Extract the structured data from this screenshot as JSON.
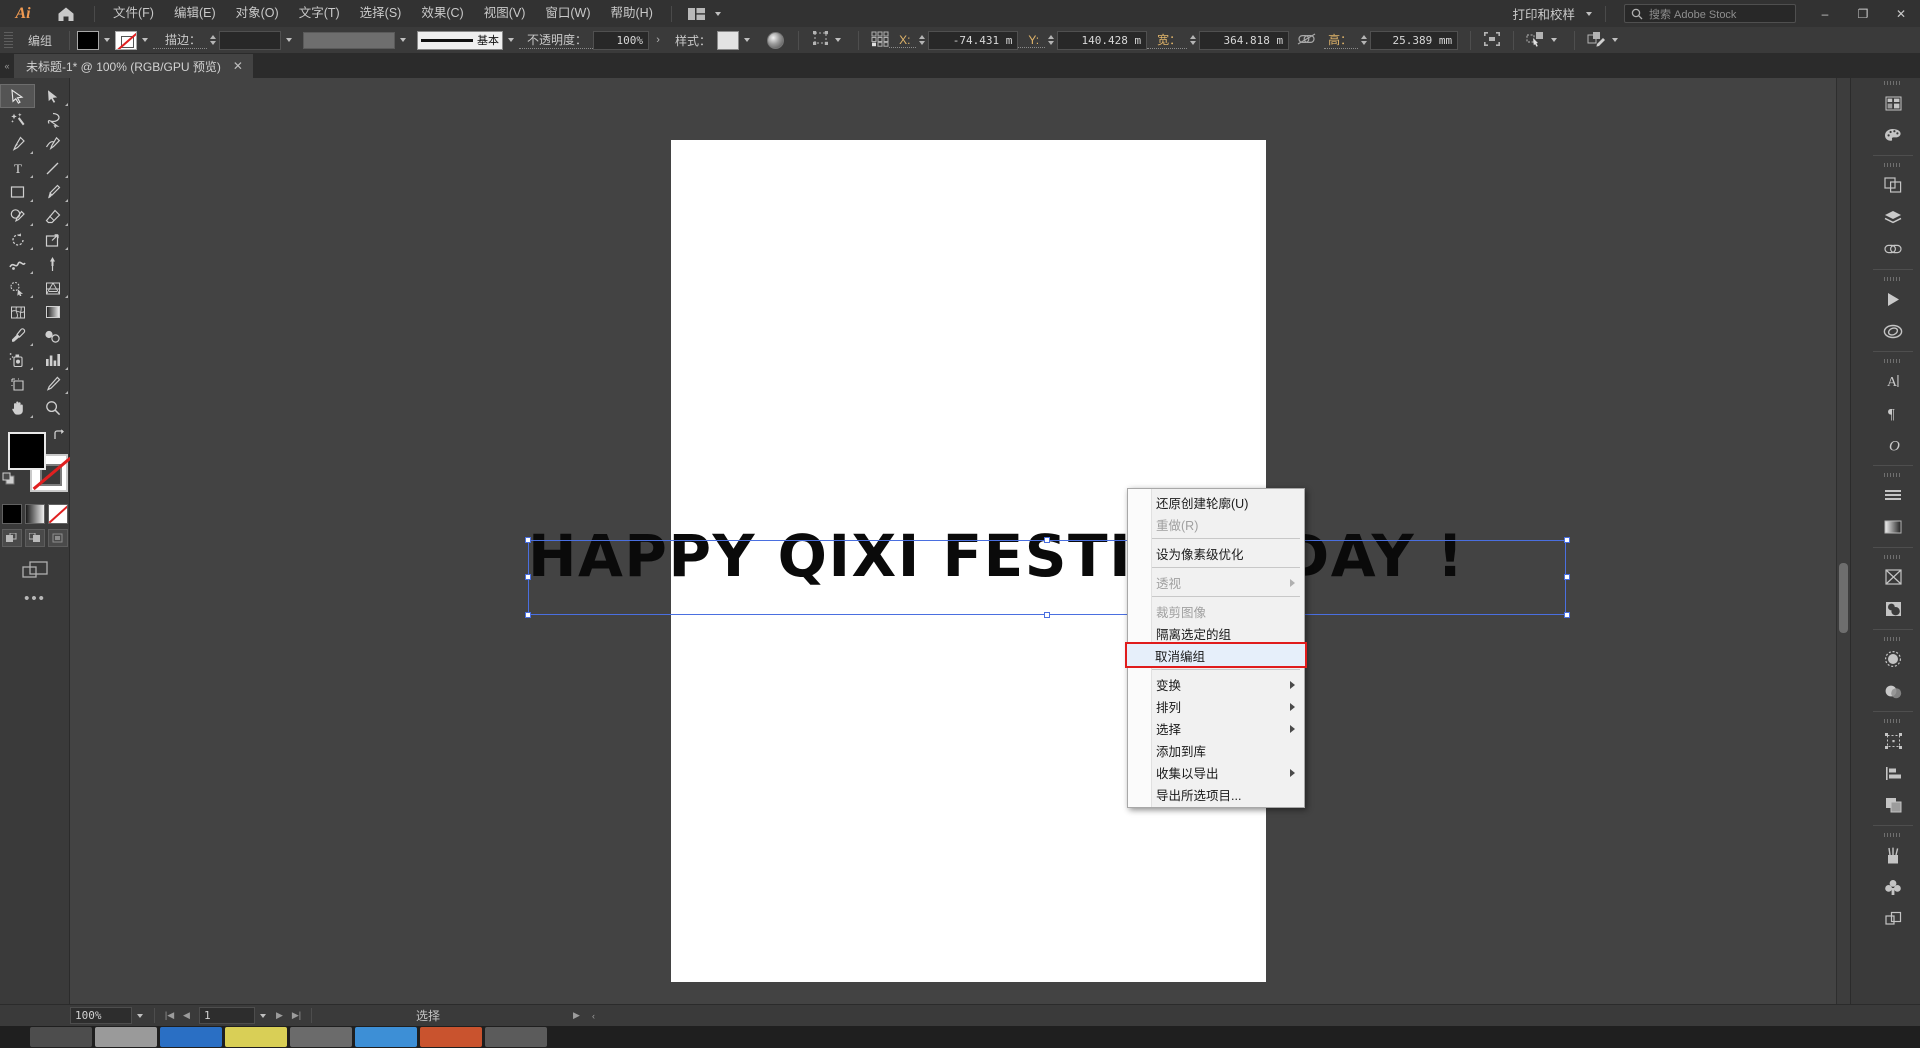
{
  "app": {
    "name": "Ai",
    "logo_icon": "illustrator-logo-icon",
    "home_icon": "home-icon"
  },
  "menubar": {
    "items": [
      {
        "label": "文件(F)",
        "name": "menu-file"
      },
      {
        "label": "编辑(E)",
        "name": "menu-edit"
      },
      {
        "label": "对象(O)",
        "name": "menu-object"
      },
      {
        "label": "文字(T)",
        "name": "menu-type"
      },
      {
        "label": "选择(S)",
        "name": "menu-select"
      },
      {
        "label": "效果(C)",
        "name": "menu-effect"
      },
      {
        "label": "视图(V)",
        "name": "menu-view"
      },
      {
        "label": "窗口(W)",
        "name": "menu-window"
      },
      {
        "label": "帮助(H)",
        "name": "menu-help"
      }
    ],
    "arrange_icon": "arrange-documents-icon",
    "workspace_label": "打印和校样",
    "search_placeholder": "搜索 Adobe Stock",
    "search_icon": "search-icon",
    "minimize": "–",
    "restore": "❐",
    "close": "✕"
  },
  "controlbar": {
    "selection_label": "编组",
    "fill_color": "#000000",
    "stroke_label": "描边：",
    "stroke_value": "",
    "stroke_profile_label": "基本",
    "opacity_label": "不透明度：",
    "opacity_value": "100%",
    "style_label": "样式：",
    "x_label": "X:",
    "x_value": "-74.431 m",
    "y_label": "Y:",
    "y_value": "140.428 m",
    "w_label": "宽：",
    "w_value": "364.818 m",
    "h_label": "高：",
    "h_value": "25.389 mm",
    "transform_icon": "transform-icon",
    "align_icon": "align-reference-icon",
    "link_icon": "constrain-proportions-icon",
    "distribute_icon": "distribute-icon",
    "select_similar_icon": "select-similar-icon",
    "more_options_icon": "more-options-icon"
  },
  "tabbar": {
    "tab_title": "未标题-1* @ 100% (RGB/GPU 预览)",
    "close_icon": "close-icon"
  },
  "toolbar": {
    "tools": [
      {
        "name": "selection-tool",
        "icon": "arrow-cursor-icon",
        "selected": true,
        "flyout": false
      },
      {
        "name": "direct-selection-tool",
        "icon": "direct-arrow-icon",
        "selected": false,
        "flyout": true
      },
      {
        "name": "magic-wand-tool",
        "icon": "magic-wand-icon",
        "selected": false,
        "flyout": false
      },
      {
        "name": "lasso-tool",
        "icon": "lasso-icon",
        "selected": false,
        "flyout": false
      },
      {
        "name": "pen-tool",
        "icon": "pen-icon",
        "selected": false,
        "flyout": true
      },
      {
        "name": "curvature-tool",
        "icon": "curvature-icon",
        "selected": false,
        "flyout": false
      },
      {
        "name": "type-tool",
        "icon": "type-T-icon",
        "selected": false,
        "flyout": true
      },
      {
        "name": "line-segment-tool",
        "icon": "line-icon",
        "selected": false,
        "flyout": true
      },
      {
        "name": "rectangle-tool",
        "icon": "rectangle-icon",
        "selected": false,
        "flyout": true
      },
      {
        "name": "paintbrush-tool",
        "icon": "paintbrush-icon",
        "selected": false,
        "flyout": true
      },
      {
        "name": "shaper-tool",
        "icon": "shaper-pencil-icon",
        "selected": false,
        "flyout": true
      },
      {
        "name": "eraser-tool",
        "icon": "eraser-icon",
        "selected": false,
        "flyout": true
      },
      {
        "name": "rotate-tool",
        "icon": "rotate-icon",
        "selected": false,
        "flyout": true
      },
      {
        "name": "scale-tool",
        "icon": "scale-icon",
        "selected": false,
        "flyout": true
      },
      {
        "name": "width-tool",
        "icon": "width-warp-icon",
        "selected": false,
        "flyout": true
      },
      {
        "name": "free-transform-tool",
        "icon": "pushpin-icon",
        "selected": false,
        "flyout": false
      },
      {
        "name": "shape-builder-tool",
        "icon": "shape-builder-icon",
        "selected": false,
        "flyout": true
      },
      {
        "name": "perspective-grid-tool",
        "icon": "perspective-grid-icon",
        "selected": false,
        "flyout": true
      },
      {
        "name": "mesh-tool",
        "icon": "mesh-icon",
        "selected": false,
        "flyout": false
      },
      {
        "name": "gradient-tool",
        "icon": "gradient-icon",
        "selected": false,
        "flyout": false
      },
      {
        "name": "eyedropper-tool",
        "icon": "eyedropper-icon",
        "selected": false,
        "flyout": true
      },
      {
        "name": "blend-tool",
        "icon": "blend-icon",
        "selected": false,
        "flyout": false
      },
      {
        "name": "symbol-sprayer-tool",
        "icon": "symbol-sprayer-icon",
        "selected": false,
        "flyout": true
      },
      {
        "name": "column-graph-tool",
        "icon": "bar-chart-icon",
        "selected": false,
        "flyout": true
      },
      {
        "name": "artboard-tool",
        "icon": "artboard-icon",
        "selected": false,
        "flyout": false
      },
      {
        "name": "slice-tool",
        "icon": "slice-knife-icon",
        "selected": false,
        "flyout": true
      },
      {
        "name": "hand-tool",
        "icon": "hand-icon",
        "selected": false,
        "flyout": true
      },
      {
        "name": "zoom-tool",
        "icon": "magnifier-icon",
        "selected": false,
        "flyout": false
      }
    ],
    "fill_color": "#000000",
    "stroke_color": "none",
    "swap_icon": "swap-fill-stroke-icon",
    "default_icon": "default-fill-stroke-icon",
    "color_mode_icon": "flat-color-icon",
    "gradient_mode_icon": "gradient-color-icon",
    "none_mode_icon": "none-color-icon",
    "draw_normal_icon": "draw-normal-icon",
    "draw_behind_icon": "draw-behind-icon",
    "draw_inside_icon": "draw-inside-icon",
    "screen_mode_icon": "screen-mode-icon",
    "edit_toolbar_icon": "edit-toolbar-dots-icon"
  },
  "canvas": {
    "artwork_text": "HAPPY QIXI FESTIVAL DAY !",
    "selection_color": "#4a6fe0",
    "artboard_color": "#ffffff",
    "canvas_bg": "#434343"
  },
  "contextmenu": {
    "items": [
      {
        "label": "还原创建轮廓(U)",
        "name": "ctx-undo-create-outlines",
        "disabled": false,
        "submenu": false,
        "highlighted": false
      },
      {
        "label": "重做(R)",
        "name": "ctx-redo",
        "disabled": true,
        "submenu": false,
        "highlighted": false
      },
      {
        "sep": true
      },
      {
        "label": "设为像素级优化",
        "name": "ctx-make-pixel-perfect",
        "disabled": false,
        "submenu": false,
        "highlighted": false
      },
      {
        "sep": true
      },
      {
        "label": "透视",
        "name": "ctx-perspective",
        "disabled": true,
        "submenu": true,
        "highlighted": false
      },
      {
        "sep": true
      },
      {
        "label": "裁剪图像",
        "name": "ctx-crop-image",
        "disabled": true,
        "submenu": false,
        "highlighted": false
      },
      {
        "label": "隔离选定的组",
        "name": "ctx-isolate-selected-group",
        "disabled": false,
        "submenu": false,
        "highlighted": false
      },
      {
        "label": "取消编组",
        "name": "ctx-ungroup",
        "disabled": false,
        "submenu": false,
        "highlighted": true
      },
      {
        "sep": true
      },
      {
        "label": "变换",
        "name": "ctx-transform",
        "disabled": false,
        "submenu": true,
        "highlighted": false
      },
      {
        "label": "排列",
        "name": "ctx-arrange",
        "disabled": false,
        "submenu": true,
        "highlighted": false
      },
      {
        "label": "选择",
        "name": "ctx-select",
        "disabled": false,
        "submenu": true,
        "highlighted": false
      },
      {
        "label": "添加到库",
        "name": "ctx-add-to-library",
        "disabled": false,
        "submenu": false,
        "highlighted": false
      },
      {
        "label": "收集以导出",
        "name": "ctx-collect-for-export",
        "disabled": false,
        "submenu": true,
        "highlighted": false
      },
      {
        "label": "导出所选项目...",
        "name": "ctx-export-selection",
        "disabled": false,
        "submenu": false,
        "highlighted": false
      }
    ],
    "highlight_color": "#e01c1c"
  },
  "rightdock": {
    "groups": [
      {
        "icons": [
          {
            "name": "properties-panel-icon",
            "icon": "properties-grid-icon"
          },
          {
            "name": "color-panel-icon",
            "icon": "palette-icon"
          }
        ]
      },
      {
        "icons": [
          {
            "name": "pathfinder-panel-icon",
            "icon": "pathfinder-icon"
          },
          {
            "name": "layers-panel-icon",
            "icon": "layers-stack-icon"
          },
          {
            "name": "links-panel-icon",
            "icon": "chain-link-icon"
          }
        ]
      },
      {
        "icons": [
          {
            "name": "actions-panel-icon",
            "icon": "play-triangle-icon"
          },
          {
            "name": "creative-cloud-libraries-icon",
            "icon": "cc-libraries-icon"
          }
        ]
      },
      {
        "icons": [
          {
            "name": "character-panel-icon",
            "icon": "character-A-icon"
          },
          {
            "name": "paragraph-panel-icon",
            "icon": "pilcrow-icon"
          },
          {
            "name": "glyphs-panel-icon",
            "icon": "glyph-O-icon"
          }
        ]
      },
      {
        "icons": [
          {
            "name": "align-panel-icon",
            "icon": "align-lines-icon"
          },
          {
            "name": "gradient-panel-icon",
            "icon": "gradient-bar-icon"
          }
        ]
      },
      {
        "icons": [
          {
            "name": "image-trace-panel-icon",
            "icon": "image-trace-icon"
          },
          {
            "name": "transparency-panel-icon",
            "icon": "transparency-icon"
          }
        ]
      },
      {
        "icons": [
          {
            "name": "appearance-panel-icon",
            "icon": "appearance-circle-icon"
          },
          {
            "name": "graphic-styles-panel-icon",
            "icon": "graphic-styles-icon"
          }
        ]
      },
      {
        "icons": [
          {
            "name": "transform-panel-icon",
            "icon": "transform-box-icon"
          },
          {
            "name": "align-objects-panel-icon",
            "icon": "align-objects-icon"
          },
          {
            "name": "artboards-panel-icon",
            "icon": "artboards-icon"
          }
        ]
      },
      {
        "icons": [
          {
            "name": "brushes-panel-icon",
            "icon": "brushes-cup-icon"
          },
          {
            "name": "symbols-panel-icon",
            "icon": "symbols-clover-icon"
          },
          {
            "name": "asset-export-panel-icon",
            "icon": "asset-export-icon"
          }
        ]
      }
    ]
  },
  "statusbar": {
    "zoom_value": "100%",
    "page_value": "1",
    "status_text": "选择",
    "first_icon": "first-page-icon",
    "prev_icon": "prev-page-icon",
    "next_icon": "next-page-icon",
    "last_icon": "last-page-icon",
    "play_icon": "play-icon",
    "collapse_icon": "collapse-icon"
  }
}
